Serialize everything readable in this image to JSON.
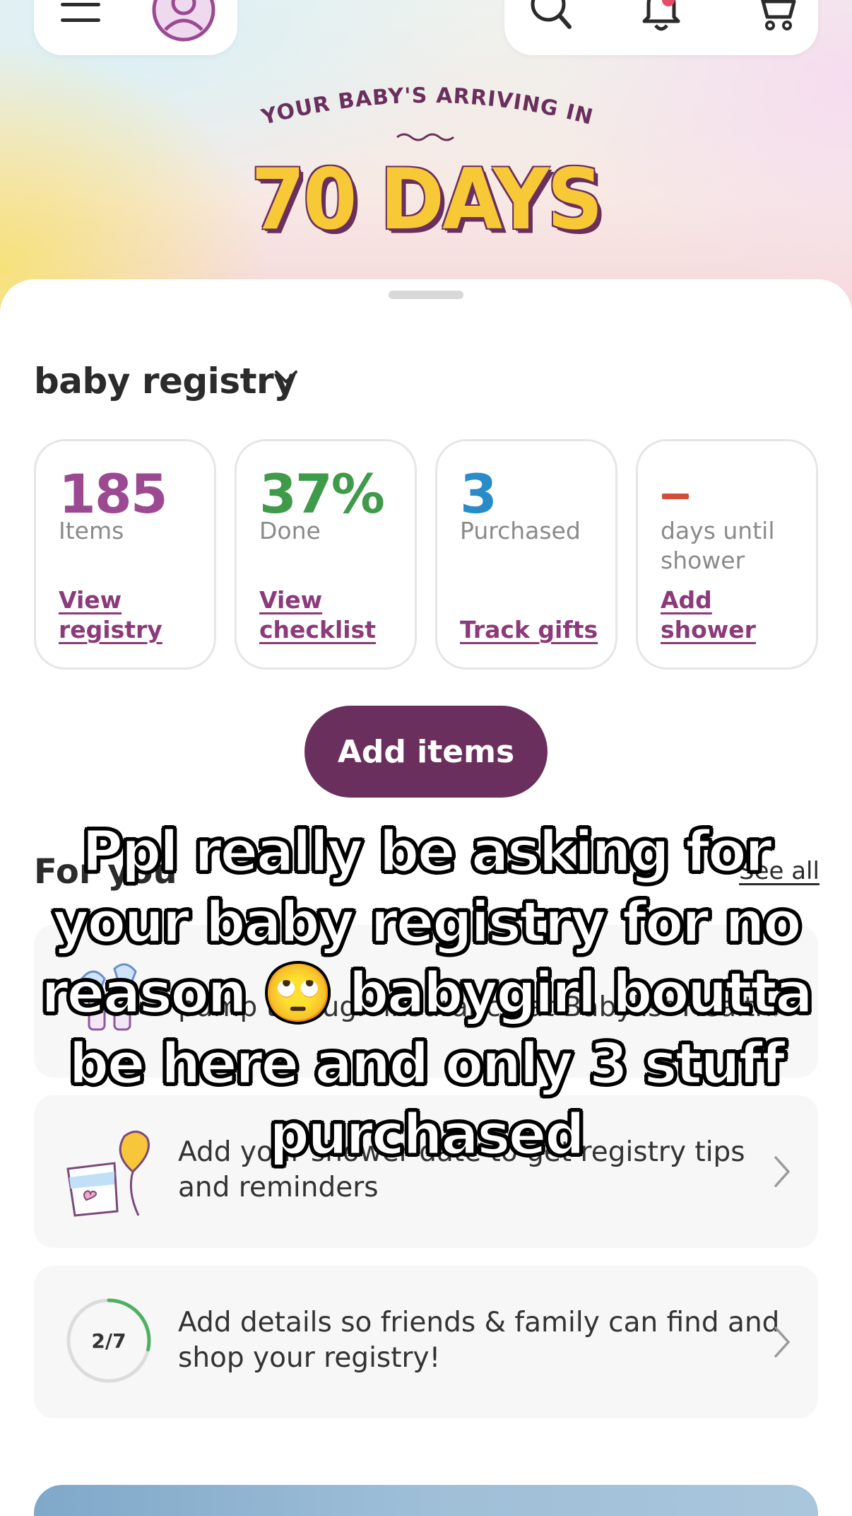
{
  "hero": {
    "arriving_text": "YOUR BABY'S ARRIVING IN",
    "days_text": "70 DAYS"
  },
  "registry": {
    "title": "baby registry",
    "stats": [
      {
        "value": "185",
        "label": "Items",
        "link": "View registry",
        "color": "#9b4a92"
      },
      {
        "value": "37%",
        "label": "Done",
        "link": "View checklist",
        "color": "#3f9a4a"
      },
      {
        "value": "3",
        "label": "Purchased",
        "link": "Track gifts",
        "color": "#2a8bc9"
      },
      {
        "value": "",
        "label": "days until shower",
        "link": "Add shower",
        "color": "#d14f3a"
      }
    ],
    "add_items_label": "Add items"
  },
  "for_you": {
    "title": "For you",
    "see_all": "See all",
    "items": [
      {
        "text": "pump through insurance at Babylist Health"
      },
      {
        "text": "Add your shower date to get registry tips and reminders"
      },
      {
        "text": "Add details so friends & family can find and shop your registry!",
        "progress_label": "2/7",
        "progress": 0.2857
      }
    ]
  },
  "overlay": {
    "caption": "Ppl really be asking for your baby registry for no reason 🙄 babygirl boutta be here and only 3 stuff purchased"
  },
  "colors": {
    "brand_purple": "#6b2f5e",
    "link_purple": "#8b3a7a",
    "days_yellow": "#f7c937"
  }
}
